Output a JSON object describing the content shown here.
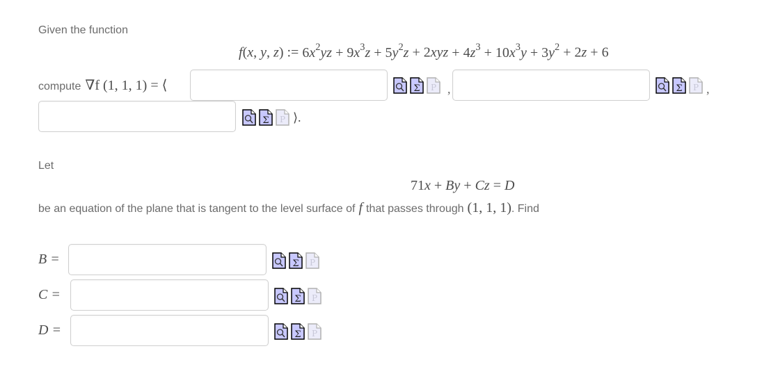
{
  "intro": {
    "given_label": "Given the function",
    "function_def": {
      "lhs": "f(x, y, z) :=",
      "terms": [
        {
          "text": "6x",
          "sup": "2",
          "after": "yz"
        },
        {
          "op": "+",
          "text": "9x",
          "sup": "3",
          "after": "z"
        },
        {
          "op": "+",
          "text": "5y",
          "sup": "2",
          "after": "z"
        },
        {
          "op": "+",
          "text": "2xyz",
          "sup": "",
          "after": ""
        },
        {
          "op": "+",
          "text": "4z",
          "sup": "3",
          "after": ""
        },
        {
          "op": "+",
          "text": "10x",
          "sup": "3",
          "after": "y"
        },
        {
          "op": "+",
          "text": "3y",
          "sup": "2",
          "after": ""
        },
        {
          "op": "+",
          "text": "2z",
          "sup": "",
          "after": ""
        },
        {
          "op": "+",
          "text": "6",
          "sup": "",
          "after": ""
        }
      ]
    },
    "compute_label": "compute",
    "gradient_expr": "∇f (1, 1, 1) = ⟨",
    "separator_comma": ",",
    "closing": "⟩."
  },
  "gradient_inputs": [
    {
      "name": "gradient-x",
      "value": "",
      "placeholder": ""
    },
    {
      "name": "gradient-y",
      "value": "",
      "placeholder": ""
    },
    {
      "name": "gradient-z",
      "value": "",
      "placeholder": ""
    }
  ],
  "plane": {
    "let_label": "Let",
    "equation": "71x + By + Cz = D",
    "description_before": "be an equation of the plane that is tangent to the level surface of",
    "f_symbol": "f",
    "description_middle": "that passes through",
    "point": "(1, 1, 1)",
    "description_after": ". Find"
  },
  "answers": [
    {
      "label": "B =",
      "value": "",
      "placeholder": ""
    },
    {
      "label": "C =",
      "value": "",
      "placeholder": ""
    },
    {
      "label": "D =",
      "value": "",
      "placeholder": ""
    }
  ],
  "icon_tools": [
    "preview-icon",
    "equation-editor-icon",
    "parse-icon-disabled"
  ],
  "colors": {
    "text": "#6b6b6b",
    "math": "#4d4d4d",
    "icon_fill": "#c8c8ff",
    "icon_stroke": "#000000",
    "icon_disabled_fill": "#ececfa",
    "icon_disabled_stroke": "#b0b0b0",
    "field_border": "#cfcfcf"
  }
}
